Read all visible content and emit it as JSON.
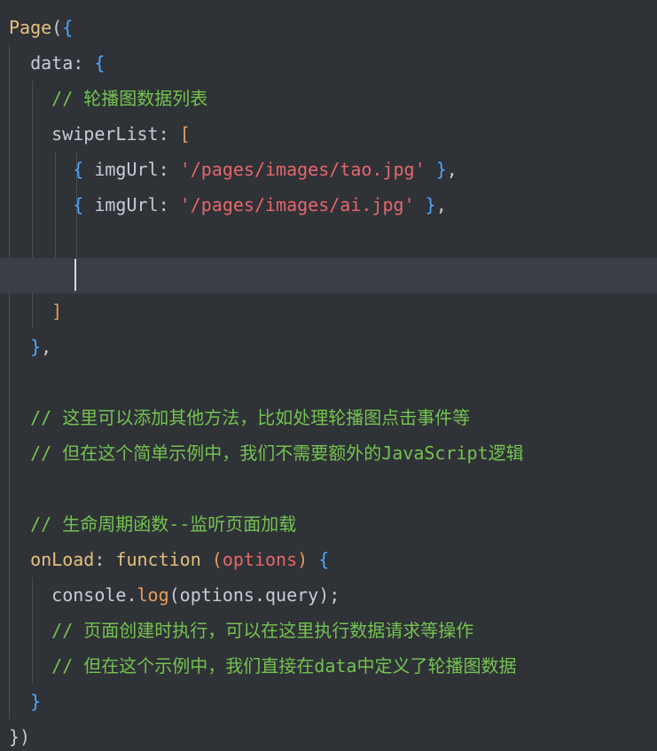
{
  "editor": {
    "language": "javascript",
    "colors": {
      "background": "#2f3237",
      "current_line": "#3b3e45",
      "default": "#c8ccd4",
      "keyword": "#c678dd",
      "brace": "#51a6ff",
      "property": "#56d1bf",
      "string": "#e5676a",
      "comment": "#74c34f",
      "function_name": "#e5c07b",
      "method": "#e59d5f",
      "param": "#e5676a",
      "punct": "#c8ccd4"
    },
    "lines": [
      [
        {
          "t": "Page",
          "c": "function_name"
        },
        {
          "t": "(",
          "c": "punct"
        },
        {
          "t": "{",
          "c": "brace"
        }
      ],
      [
        {
          "t": "  data",
          "c": "default"
        },
        {
          "t": ": ",
          "c": "punct"
        },
        {
          "t": "{",
          "c": "brace"
        }
      ],
      [
        {
          "t": "    // 轮播图数据列表",
          "c": "comment"
        }
      ],
      [
        {
          "t": "    swiperList",
          "c": "default"
        },
        {
          "t": ": ",
          "c": "punct"
        },
        {
          "t": "[",
          "c": "method"
        }
      ],
      [
        {
          "t": "      ",
          "c": "default"
        },
        {
          "t": "{",
          "c": "brace"
        },
        {
          "t": " imgUrl",
          "c": "default"
        },
        {
          "t": ": ",
          "c": "punct"
        },
        {
          "t": "'/pages/images/tao.jpg'",
          "c": "string"
        },
        {
          "t": " ",
          "c": "default"
        },
        {
          "t": "}",
          "c": "brace"
        },
        {
          "t": ",",
          "c": "punct"
        }
      ],
      [
        {
          "t": "      ",
          "c": "default"
        },
        {
          "t": "{",
          "c": "brace"
        },
        {
          "t": " imgUrl",
          "c": "default"
        },
        {
          "t": ": ",
          "c": "punct"
        },
        {
          "t": "'/pages/images/ai.jpg'",
          "c": "string"
        },
        {
          "t": " ",
          "c": "default"
        },
        {
          "t": "}",
          "c": "brace"
        },
        {
          "t": ",",
          "c": "punct"
        }
      ],
      [],
      [],
      [
        {
          "t": "    ]",
          "c": "method"
        }
      ],
      [
        {
          "t": "  ",
          "c": "default"
        },
        {
          "t": "}",
          "c": "brace"
        },
        {
          "t": ",",
          "c": "punct"
        }
      ],
      [],
      [
        {
          "t": "  // 这里可以添加其他方法，比如处理轮播图点击事件等",
          "c": "comment"
        }
      ],
      [
        {
          "t": "  // 但在这个简单示例中，我们不需要额外的JavaScript逻辑",
          "c": "comment"
        }
      ],
      [],
      [
        {
          "t": "  // 生命周期函数--监听页面加载",
          "c": "comment"
        }
      ],
      [
        {
          "t": "  onLoad",
          "c": "function_name"
        },
        {
          "t": ": ",
          "c": "punct"
        },
        {
          "t": "function",
          "c": "function_name"
        },
        {
          "t": " ",
          "c": "default"
        },
        {
          "t": "(",
          "c": "method"
        },
        {
          "t": "options",
          "c": "param"
        },
        {
          "t": ")",
          "c": "method"
        },
        {
          "t": " ",
          "c": "default"
        },
        {
          "t": "{",
          "c": "brace"
        }
      ],
      [
        {
          "t": "    console",
          "c": "default"
        },
        {
          "t": ".",
          "c": "punct"
        },
        {
          "t": "log",
          "c": "method"
        },
        {
          "t": "(options",
          "c": "default"
        },
        {
          "t": ".",
          "c": "punct"
        },
        {
          "t": "query);",
          "c": "default"
        }
      ],
      [
        {
          "t": "    // 页面创建时执行，可以在这里执行数据请求等操作",
          "c": "comment"
        }
      ],
      [
        {
          "t": "    // 但在这个示例中，我们直接在data中定义了轮播图数据",
          "c": "comment"
        }
      ],
      [
        {
          "t": "  ",
          "c": "default"
        },
        {
          "t": "}",
          "c": "brace"
        }
      ],
      [
        {
          "t": "})",
          "c": "punct"
        }
      ]
    ]
  }
}
